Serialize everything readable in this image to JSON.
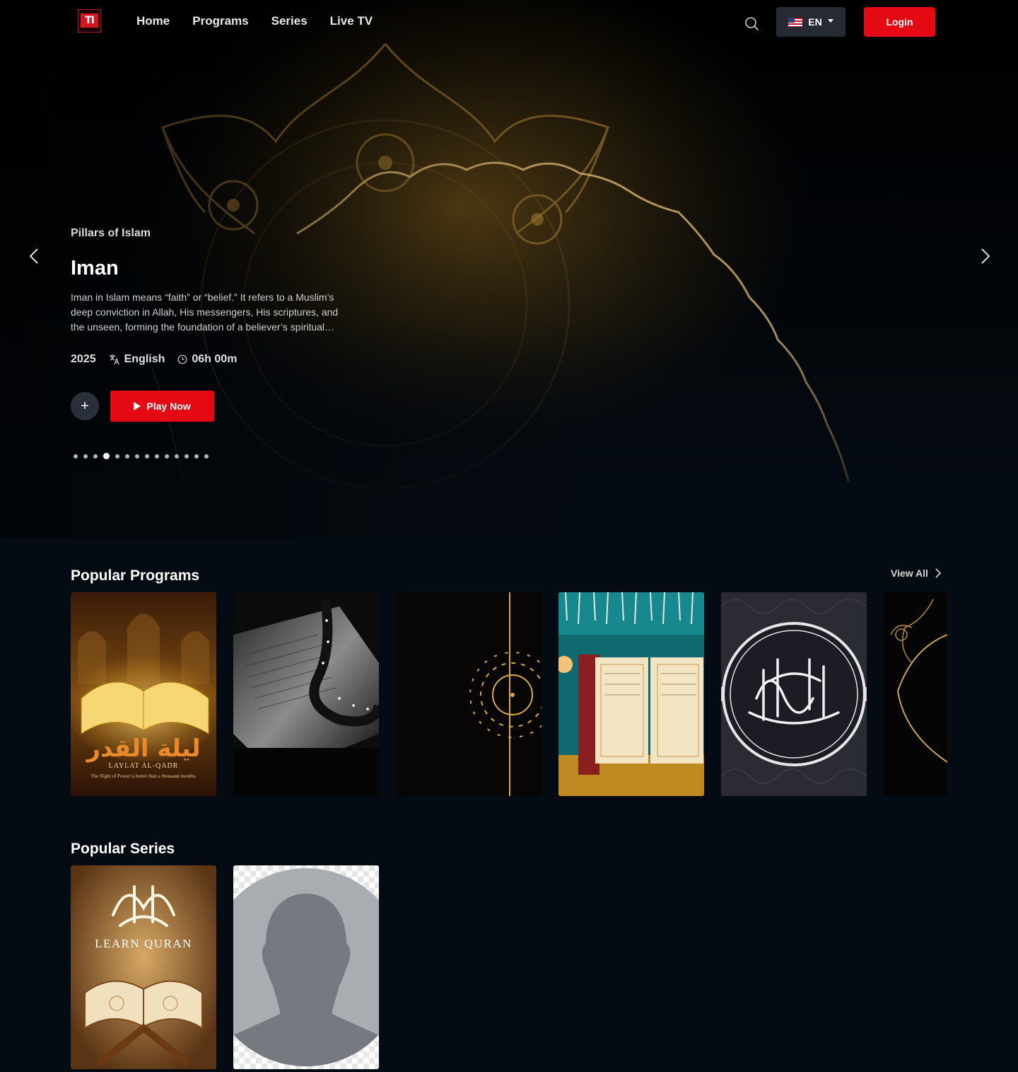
{
  "header": {
    "logo_text": "TI",
    "nav": [
      "Home",
      "Programs",
      "Series",
      "Live TV"
    ],
    "language": "EN",
    "login_label": "Login"
  },
  "hero": {
    "subtitle": "Pillars of Islam",
    "title": "Iman",
    "description": "Iman in Islam means “faith” or “belief.” It refers to a Muslim’s deep conviction in Allah, His messengers, His scriptures, and the unseen, forming the foundation of a believer’s spiritual and moral life.",
    "year": "2025",
    "language": "English",
    "duration": "06h 00m",
    "play_label": "Play Now",
    "add_label": "+",
    "slide_count": 14,
    "active_slide": 4
  },
  "popular_programs": {
    "title": "Popular Programs",
    "view_all_label": "View All",
    "cards": [
      {
        "name": "laylat-al-qadr",
        "title_ar": "ليلة القدر",
        "title_en": "LAYLAT AL-QADR",
        "tagline": "The Night of Power is better than a thousand months."
      },
      {
        "name": "quran-prayer-beads"
      },
      {
        "name": "golden-crescent"
      },
      {
        "name": "quran-on-prayer-mat"
      },
      {
        "name": "calligraphy-medallion"
      },
      {
        "name": "golden-mandala"
      }
    ]
  },
  "popular_series": {
    "title": "Popular Series",
    "cards": [
      {
        "name": "learn-quran",
        "title_en": "LEARN QURAN"
      },
      {
        "name": "placeholder-avatar"
      }
    ]
  },
  "colors": {
    "accent": "#e50914",
    "background": "#050b12",
    "gold": "#c9a24a"
  }
}
